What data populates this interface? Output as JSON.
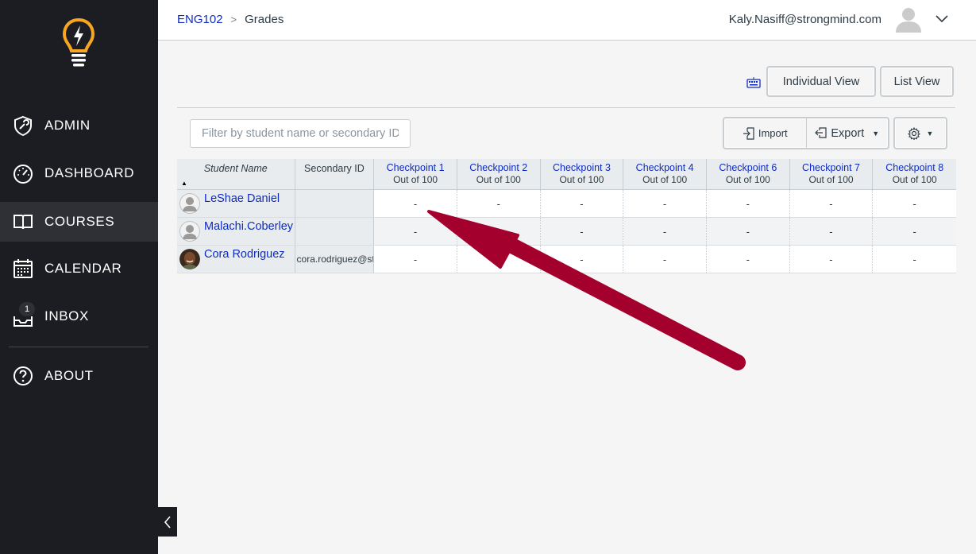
{
  "sidebar": {
    "items": [
      {
        "label": "ADMIN",
        "icon": "admin-icon"
      },
      {
        "label": "DASHBOARD",
        "icon": "dashboard-icon"
      },
      {
        "label": "COURSES",
        "icon": "book-icon"
      },
      {
        "label": "CALENDAR",
        "icon": "calendar-icon"
      },
      {
        "label": "INBOX",
        "icon": "inbox-icon",
        "badge": "1"
      },
      {
        "label": "ABOUT",
        "icon": "question-icon"
      }
    ]
  },
  "header": {
    "breadcrumb_course": "ENG102",
    "breadcrumb_page": "Grades",
    "user_email": "Kaly.Nasiff@strongmind.com"
  },
  "toolbar": {
    "individual_view": "Individual View",
    "list_view": "List View",
    "filter_placeholder": "Filter by student name or secondary ID",
    "import": "Import",
    "export": "Export"
  },
  "grid": {
    "col_student": "Student Name",
    "col_secondary": "Secondary ID",
    "assignments": [
      {
        "title": "Checkpoint 1",
        "sub": "Out of 100"
      },
      {
        "title": "Checkpoint 2",
        "sub": "Out of 100"
      },
      {
        "title": "Checkpoint 3",
        "sub": "Out of 100"
      },
      {
        "title": "Checkpoint 4",
        "sub": "Out of 100"
      },
      {
        "title": "Checkpoint 6",
        "sub": "Out of 100"
      },
      {
        "title": "Checkpoint 7",
        "sub": "Out of 100"
      },
      {
        "title": "Checkpoint 8",
        "sub": "Out of 100"
      }
    ],
    "students": [
      {
        "name": "LeShae Daniel",
        "secondary_id": "",
        "scores": [
          "-",
          "-",
          "-",
          "-",
          "-",
          "-",
          "-"
        ]
      },
      {
        "name": "Malachi.Coberley",
        "secondary_id": "",
        "scores": [
          "-",
          "-",
          "-",
          "-",
          "-",
          "-",
          "-"
        ]
      },
      {
        "name": "Cora Rodriguez",
        "secondary_id": "cora.rodriguez@st",
        "scores": [
          "-",
          "-",
          "-",
          "-",
          "-",
          "-",
          "-"
        ]
      }
    ]
  },
  "colors": {
    "sidebar_bg": "#1c1d22",
    "link": "#0f2cc0",
    "annotation_arrow": "#a3002e",
    "logo": "#f6a623"
  }
}
